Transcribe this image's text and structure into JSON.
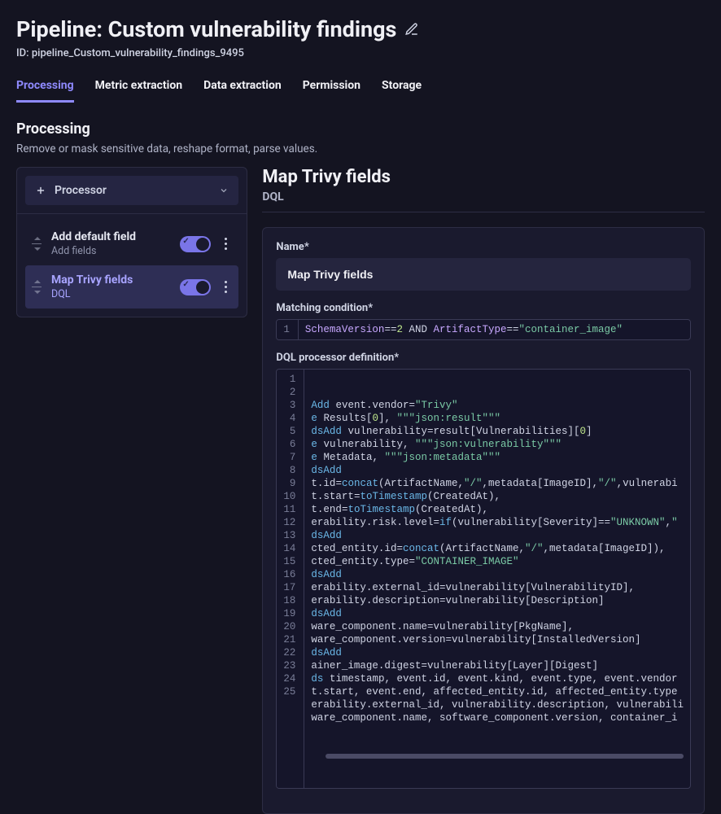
{
  "title": "Pipeline: Custom vulnerability findings",
  "id_label": "ID: pipeline_Custom_vulnerability_findings_9495",
  "tabs": [
    "Processing",
    "Metric extraction",
    "Data extraction",
    "Permission",
    "Storage"
  ],
  "section": {
    "title": "Processing",
    "desc": "Remove or mask sensitive data, reshape format, parse values."
  },
  "left": {
    "add_label": "Processor",
    "items": [
      {
        "title": "Add default field",
        "sub": "Add fields",
        "on": true,
        "selected": false
      },
      {
        "title": "Map Trivy fields",
        "sub": "DQL",
        "on": true,
        "selected": true
      }
    ]
  },
  "right": {
    "title": "Map Trivy fields",
    "sub": "DQL",
    "name_label": "Name*",
    "name_value": "Map Trivy fields",
    "matching_label": "Matching condition*",
    "matching_code": {
      "tokens": [
        {
          "t": "SchemaVersion",
          "c": "kw1"
        },
        {
          "t": "==",
          "c": "op"
        },
        {
          "t": "2",
          "c": "num"
        },
        {
          "t": " AND ",
          "c": "op"
        },
        {
          "t": "ArtifactType",
          "c": "kw1"
        },
        {
          "t": "==",
          "c": "op"
        },
        {
          "t": "\"container_image\"",
          "c": "str"
        }
      ]
    },
    "dql_label": "DQL processor definition*",
    "dql_lines": [
      [
        {
          "t": "Add ",
          "c": "fn"
        },
        {
          "t": "event.vendor",
          "c": "id"
        },
        {
          "t": "=",
          "c": "op"
        },
        {
          "t": "\"Trivy\"",
          "c": "str"
        }
      ],
      [
        {
          "t": "e ",
          "c": "fn"
        },
        {
          "t": "Results[",
          "c": "id"
        },
        {
          "t": "0",
          "c": "num"
        },
        {
          "t": "], ",
          "c": "id"
        },
        {
          "t": "\"\"\"json:result\"\"\"",
          "c": "str"
        }
      ],
      [
        {
          "t": "dsAdd ",
          "c": "fn"
        },
        {
          "t": "vulnerability",
          "c": "id"
        },
        {
          "t": "=",
          "c": "op"
        },
        {
          "t": "result[Vulnerabilities][",
          "c": "id"
        },
        {
          "t": "0",
          "c": "num"
        },
        {
          "t": "]",
          "c": "id"
        }
      ],
      [
        {
          "t": "e ",
          "c": "fn"
        },
        {
          "t": "vulnerability, ",
          "c": "id"
        },
        {
          "t": "\"\"\"json:vulnerability\"\"\"",
          "c": "str"
        }
      ],
      [
        {
          "t": "e ",
          "c": "fn"
        },
        {
          "t": "Metadata, ",
          "c": "id"
        },
        {
          "t": "\"\"\"json:metadata\"\"\"",
          "c": "str"
        }
      ],
      [
        {
          "t": "dsAdd",
          "c": "fn"
        }
      ],
      [
        {
          "t": "t.id",
          "c": "id"
        },
        {
          "t": "=",
          "c": "op"
        },
        {
          "t": "concat",
          "c": "fn"
        },
        {
          "t": "(ArtifactName,",
          "c": "id"
        },
        {
          "t": "\"/\"",
          "c": "str"
        },
        {
          "t": ",metadata[ImageID],",
          "c": "id"
        },
        {
          "t": "\"/\"",
          "c": "str"
        },
        {
          "t": ",vulnerabi",
          "c": "id"
        }
      ],
      [
        {
          "t": "t.start",
          "c": "id"
        },
        {
          "t": "=",
          "c": "op"
        },
        {
          "t": "toTimestamp",
          "c": "fn"
        },
        {
          "t": "(CreatedAt),",
          "c": "id"
        }
      ],
      [
        {
          "t": "t.end",
          "c": "id"
        },
        {
          "t": "=",
          "c": "op"
        },
        {
          "t": "toTimestamp",
          "c": "fn"
        },
        {
          "t": "(CreatedAt),",
          "c": "id"
        }
      ],
      [
        {
          "t": "erability.risk.level",
          "c": "id"
        },
        {
          "t": "=",
          "c": "op"
        },
        {
          "t": "if",
          "c": "fn"
        },
        {
          "t": "(vulnerability[Severity]",
          "c": "id"
        },
        {
          "t": "==",
          "c": "op"
        },
        {
          "t": "\"UNKNOWN\"",
          "c": "str"
        },
        {
          "t": ",",
          "c": "id"
        },
        {
          "t": "\"",
          "c": "str"
        }
      ],
      [
        {
          "t": "dsAdd",
          "c": "fn"
        }
      ],
      [
        {
          "t": "cted_entity.id",
          "c": "id"
        },
        {
          "t": "=",
          "c": "op"
        },
        {
          "t": "concat",
          "c": "fn"
        },
        {
          "t": "(ArtifactName,",
          "c": "id"
        },
        {
          "t": "\"/\"",
          "c": "str"
        },
        {
          "t": ",metadata[ImageID]),",
          "c": "id"
        }
      ],
      [
        {
          "t": "cted_entity.type",
          "c": "id"
        },
        {
          "t": "=",
          "c": "op"
        },
        {
          "t": "\"CONTAINER_IMAGE\"",
          "c": "str"
        }
      ],
      [
        {
          "t": "dsAdd",
          "c": "fn"
        }
      ],
      [
        {
          "t": "erability.external_id",
          "c": "id"
        },
        {
          "t": "=",
          "c": "op"
        },
        {
          "t": "vulnerability[VulnerabilityID],",
          "c": "id"
        }
      ],
      [
        {
          "t": "erability.description",
          "c": "id"
        },
        {
          "t": "=",
          "c": "op"
        },
        {
          "t": "vulnerability[Description]",
          "c": "id"
        }
      ],
      [
        {
          "t": "dsAdd",
          "c": "fn"
        }
      ],
      [
        {
          "t": "ware_component.name",
          "c": "id"
        },
        {
          "t": "=",
          "c": "op"
        },
        {
          "t": "vulnerability[PkgName],",
          "c": "id"
        }
      ],
      [
        {
          "t": "ware_component.version",
          "c": "id"
        },
        {
          "t": "=",
          "c": "op"
        },
        {
          "t": "vulnerability[InstalledVersion]",
          "c": "id"
        }
      ],
      [
        {
          "t": "dsAdd",
          "c": "fn"
        }
      ],
      [
        {
          "t": "ainer_image.digest",
          "c": "id"
        },
        {
          "t": "=",
          "c": "op"
        },
        {
          "t": "vulnerability[Layer][Digest]",
          "c": "id"
        }
      ],
      [
        {
          "t": "ds ",
          "c": "fn"
        },
        {
          "t": "timestamp, event.id, event.kind, event.type, event.vendor",
          "c": "id"
        }
      ],
      [
        {
          "t": "t.start, event.end, affected_entity.id, affected_entity.type",
          "c": "id"
        }
      ],
      [
        {
          "t": "erability.external_id, vulnerability.description, vulnerabili",
          "c": "id"
        }
      ],
      [
        {
          "t": "ware_component.name, software_component.version, container_i",
          "c": "id"
        }
      ]
    ]
  }
}
